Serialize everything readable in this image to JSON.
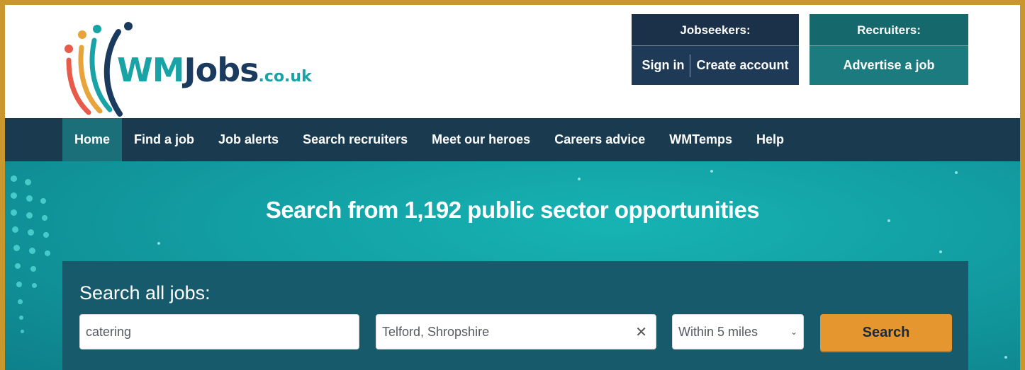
{
  "brand": {
    "logo_wm": "WM",
    "logo_jobs": "Jobs",
    "logo_domain": ".co.uk"
  },
  "jobseekers": {
    "title": "Jobseekers:",
    "sign_in": "Sign in",
    "create_account": "Create account"
  },
  "recruiters": {
    "title": "Recruiters:",
    "advertise": "Advertise a job"
  },
  "nav": {
    "items": [
      {
        "label": "Home"
      },
      {
        "label": "Find a job"
      },
      {
        "label": "Job alerts"
      },
      {
        "label": "Search recruiters"
      },
      {
        "label": "Meet our heroes"
      },
      {
        "label": "Careers advice"
      },
      {
        "label": "WMTemps"
      },
      {
        "label": "Help"
      }
    ],
    "active": "Home"
  },
  "hero": {
    "title": "Search from 1,192 public sector opportunities"
  },
  "search": {
    "label": "Search all jobs:",
    "keyword_value": "catering",
    "location_value": "Telford, Shropshire",
    "distance_value": "Within 5 miles",
    "button_label": "Search"
  },
  "icons": {
    "clear": "close-icon",
    "dropdown": "chevron-down-icon"
  },
  "colors": {
    "frame": "#c9972b",
    "navy": "#1a3a4f",
    "teal": "#1aa3a6",
    "search_button": "#e5962f"
  }
}
